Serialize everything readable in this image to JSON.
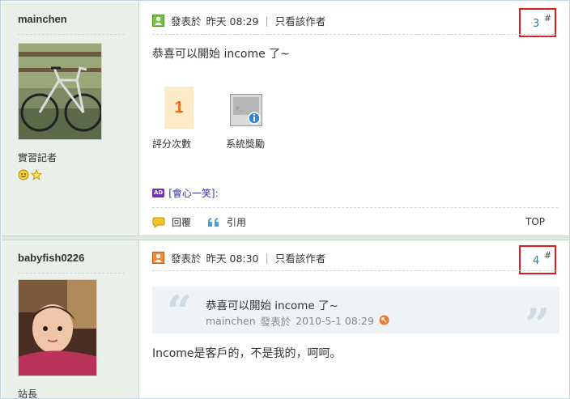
{
  "posts": [
    {
      "username": "mainchen",
      "rank": "實習記者",
      "meta_prefix": "發表於",
      "time": "昨天 08:29",
      "only_author": "只看該作者",
      "floor": "3",
      "floor_symbol": "#",
      "content": "恭喜可以開始 income 了~",
      "rate_value": "1",
      "rate_label": "評分次數",
      "reward_label": "系統獎勵",
      "ad_tag": "AD",
      "ad_text": "[會心一笑]:",
      "reply_label": "回覆",
      "quote_label": "引用",
      "top_label": "TOP"
    },
    {
      "username": "babyfish0226",
      "rank": "站長",
      "meta_prefix": "發表於",
      "time": "昨天 08:30",
      "only_author": "只看該作者",
      "floor": "4",
      "floor_symbol": "#",
      "quote_text": "恭喜可以開始 income 了~",
      "quote_author": "mainchen",
      "quote_meta_prefix": "發表於",
      "quote_time": "2010-5-1 08:29",
      "content": "Income是客戶的，不是我的，呵呵。"
    }
  ],
  "colors": {
    "sidebar_bg": "#e9efe9",
    "floor_link": "#2a7ab5",
    "highlight_box": "#e01b1b",
    "rate_text": "#f06a12",
    "ad_link": "#2a32b5"
  }
}
